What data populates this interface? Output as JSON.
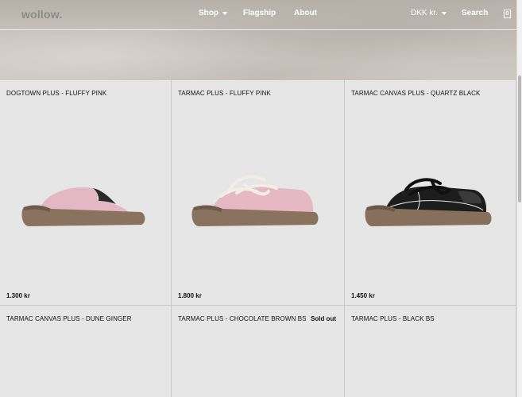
{
  "header": {
    "logo": "wollow.",
    "nav": {
      "shop": "Shop",
      "flagship": "Flagship",
      "about": "About",
      "currency": "DKK kr.",
      "search": "Search",
      "cart_count": "0"
    }
  },
  "products": [
    {
      "name": "DOGTOWN PLUS - FLUFFY PINK",
      "price": "1.300 kr",
      "sold_out": "",
      "shoe_style": "mule",
      "upper_color": "#e3b7c3",
      "sole_color": "#8a735e"
    },
    {
      "name": "TARMAC PLUS - FLUFFY PINK",
      "price": "1.800 kr",
      "sold_out": "",
      "shoe_style": "lace",
      "upper_color": "#e6b8c4",
      "sole_color": "#8a735e",
      "lace_color": "#f3eee4"
    },
    {
      "name": "TARMAC CANVAS PLUS - QUARTZ BLACK",
      "price": "1.450 kr",
      "sold_out": "",
      "shoe_style": "lace",
      "upper_color": "#1d1d1d",
      "sole_color": "#86705c",
      "lace_color": "#111111"
    },
    {
      "name": "TARMAC CANVAS PLUS - DUNE GINGER",
      "price": "",
      "sold_out": "",
      "shoe_style": "none"
    },
    {
      "name": "TARMAC PLUS - CHOCOLATE BROWN BS",
      "price": "",
      "sold_out": "Sold out",
      "shoe_style": "none"
    },
    {
      "name": "TARMAC PLUS - BLACK BS",
      "price": "",
      "sold_out": "",
      "shoe_style": "none"
    }
  ]
}
